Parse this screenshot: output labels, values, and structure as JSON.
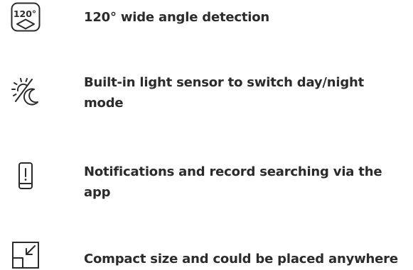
{
  "colors": {
    "text": "#2b2b2b",
    "icon": "#2b2b2b",
    "background": "#ffffff"
  },
  "features": [
    {
      "icon": "wide-angle-120-icon",
      "icon_label": "120°",
      "text": "120° wide angle detection"
    },
    {
      "icon": "sun-moon-icon",
      "text": "Built-in light sensor to switch day/night mode"
    },
    {
      "icon": "phone-notification-icon",
      "text": "Notifications and record searching via the app"
    },
    {
      "icon": "compact-size-icon",
      "text": "Compact size and could be placed anywhere"
    }
  ]
}
